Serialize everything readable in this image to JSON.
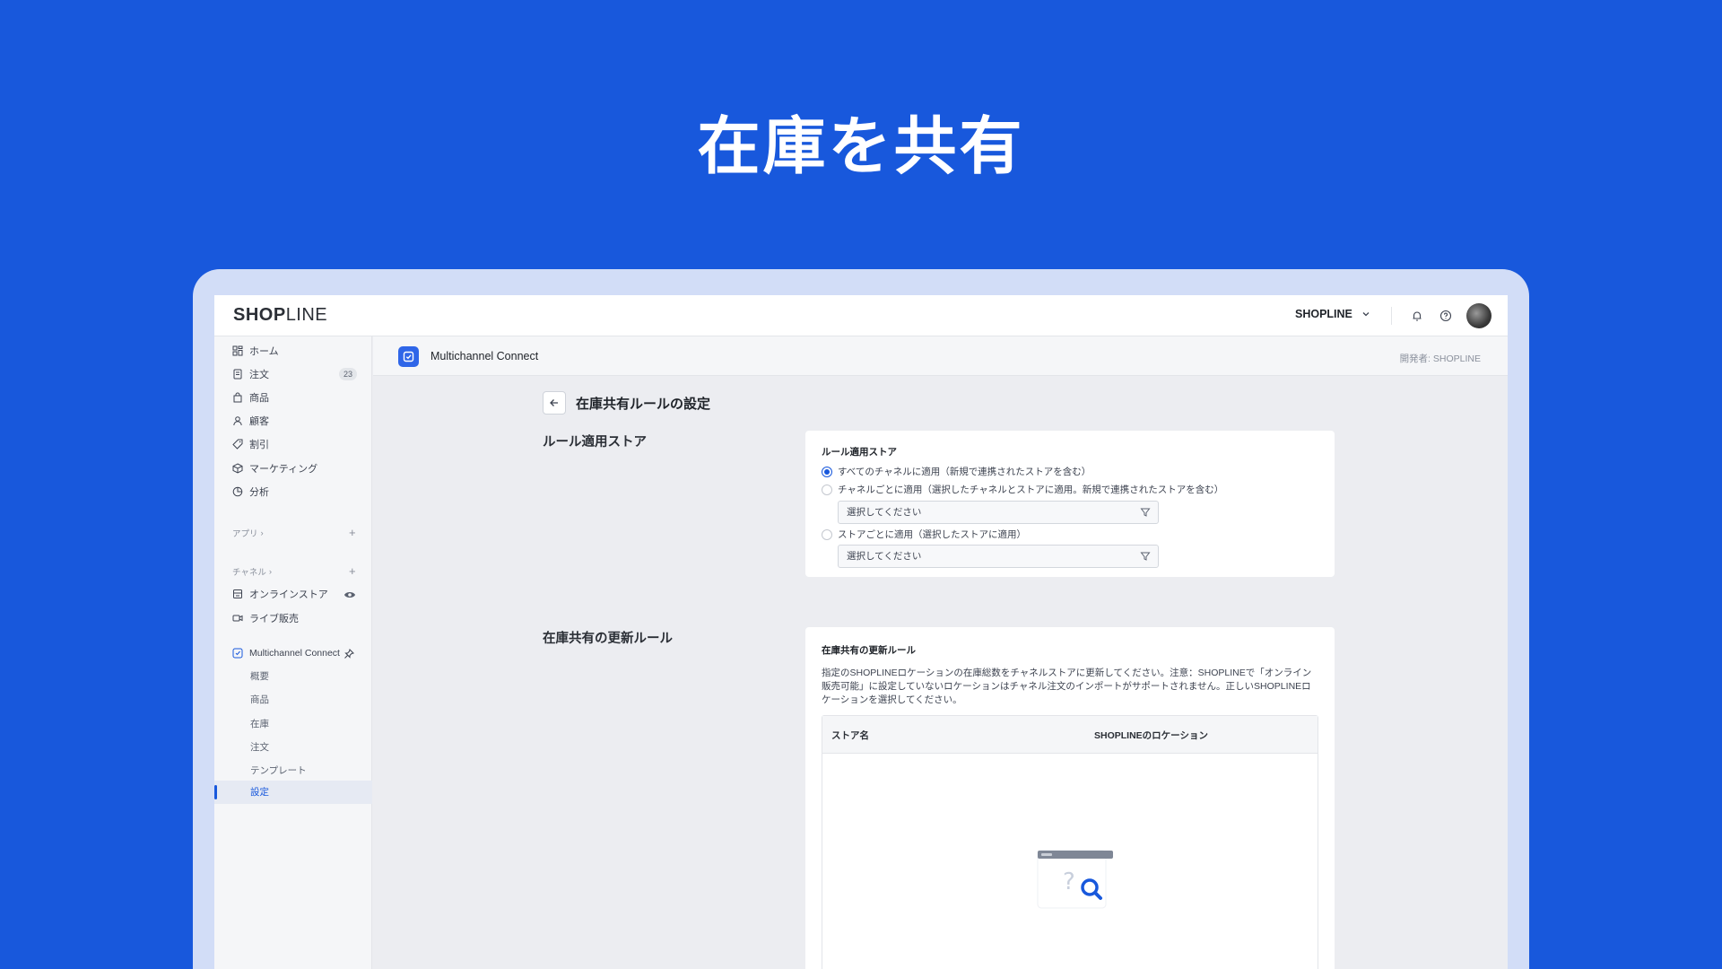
{
  "hero_title": "在庫を共有",
  "topbar": {
    "logo_left": "SHOP",
    "logo_right": "LINE",
    "store_name": "SHOPLINE"
  },
  "sidebar": {
    "items": [
      {
        "label": "ホーム",
        "icon": "home-grid-icon"
      },
      {
        "label": "注文",
        "icon": "order-icon",
        "badge": "23"
      },
      {
        "label": "商品",
        "icon": "bag-icon"
      },
      {
        "label": "顧客",
        "icon": "person-icon"
      },
      {
        "label": "割引",
        "icon": "tag-icon"
      },
      {
        "label": "マーケティング",
        "icon": "cube-icon"
      },
      {
        "label": "分析",
        "icon": "chart-icon"
      }
    ],
    "apps_label": "アプリ",
    "channels_label": "チャネル",
    "channels": [
      {
        "label": "オンラインストア",
        "icon": "store-icon"
      },
      {
        "label": "ライブ販売",
        "icon": "video-icon"
      }
    ],
    "app_name": "Multichannel Connect",
    "app_subitems": [
      "概要",
      "商品",
      "在庫",
      "注文",
      "テンプレート",
      "設定"
    ]
  },
  "subheader": {
    "app_name": "Multichannel Connect",
    "developer": "開発者: SHOPLINE"
  },
  "main": {
    "page_title": "在庫共有ルールの設定",
    "section1_label": "ルール適用ストア",
    "card1": {
      "title": "ルール適用ストア",
      "options": [
        "すべてのチャネルに適用（新規で連携されたストアを含む）",
        "チャネルごとに適用（選択したチャネルとストアに適用。新規で連携されたストアを含む）",
        "ストアごとに適用（選択したストアに適用）"
      ],
      "selected_index": 0,
      "select_placeholder_1": "選択してください",
      "select_placeholder_2": "選択してください"
    },
    "section2_label": "在庫共有の更新ルール",
    "card2": {
      "title": "在庫共有の更新ルール",
      "description": "指定のSHOPLINEロケーションの在庫総数をチャネルストアに更新してください。注意：SHOPLINEで「オンライン販売可能」に設定していないロケーションはチャネル注文のインポートがサポートされません。正しいSHOPLINEロケーションを選択してください。",
      "columns": [
        "ストア名",
        "SHOPLINEのロケーション"
      ]
    }
  },
  "colors": {
    "brand_blue": "#1858dc",
    "frame": "#d2ddf7"
  }
}
